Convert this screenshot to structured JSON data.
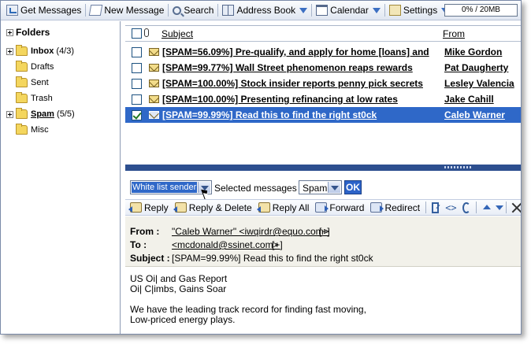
{
  "toolbar": {
    "get_messages": "Get Messages",
    "new_message": "New Message",
    "search": "Search",
    "address_book": "Address Book",
    "calendar": "Calendar",
    "settings": "Settings",
    "quota_label": "0% / 20MB",
    "quota_percent": 0
  },
  "folders": {
    "header": "Folders",
    "items": [
      {
        "name": "Inbox",
        "count": "(4/3)"
      },
      {
        "name": "Drafts",
        "count": ""
      },
      {
        "name": "Sent",
        "count": ""
      },
      {
        "name": "Trash",
        "count": ""
      },
      {
        "name": "Spam",
        "count": "(5/5)"
      },
      {
        "name": "Misc",
        "count": ""
      }
    ]
  },
  "list": {
    "col_subject": "Subject",
    "col_from": "From",
    "messages": [
      {
        "subject": "[SPAM=56.09%] Pre-qualify, and apply for home [loans] and",
        "from": "Mike Gordon",
        "checked": false,
        "selected": false
      },
      {
        "subject": "[SPAM=99.77%] Wall Street phenomenon reaps rewards",
        "from": "Pat Daugherty",
        "checked": false,
        "selected": false
      },
      {
        "subject": "[SPAM=100.00%] Stock insider reports penny pick secrets",
        "from": "Lesley Valencia",
        "checked": false,
        "selected": false
      },
      {
        "subject": "[SPAM=100.00%] Presenting refinancing at low rates",
        "from": "Jake Cahill",
        "checked": false,
        "selected": false
      },
      {
        "subject": "[SPAM=99.99%] Read this to find the right st0ck",
        "from": "Caleb Warner",
        "checked": true,
        "selected": true
      }
    ]
  },
  "actions": {
    "whitelist_value": "White list sender",
    "selected_text": "Selected messages to",
    "target_folder": "Spam",
    "ok": "OK"
  },
  "reading_toolbar": {
    "reply": "Reply",
    "reply_delete": "Reply & Delete",
    "reply_all": "Reply All",
    "forward": "Forward",
    "redirect": "Redirect"
  },
  "header": {
    "from_label": "From :",
    "from_value": "\"Caleb Warner\" <iwqirdr@equo.com>",
    "from_add": "[+]",
    "to_label": "To :",
    "to_value": "<mcdonald@ssinet.com>",
    "to_add": "[+]",
    "subject_label": "Subject :",
    "subject_value": "[SPAM=99.99%] Read this to find the right st0ck"
  },
  "body": {
    "line1": "US Oi| and Gas Report",
    "line2": "Oi| C|imbs, Gains Soar",
    "line3": "",
    "line4": "We have the leading track record for finding fast moving,",
    "line5": "Low-priced energy plays."
  },
  "colors": {
    "selection": "#2f68c8",
    "splitter": "#2d4f8f",
    "header_bg": "#f2f1ea"
  }
}
